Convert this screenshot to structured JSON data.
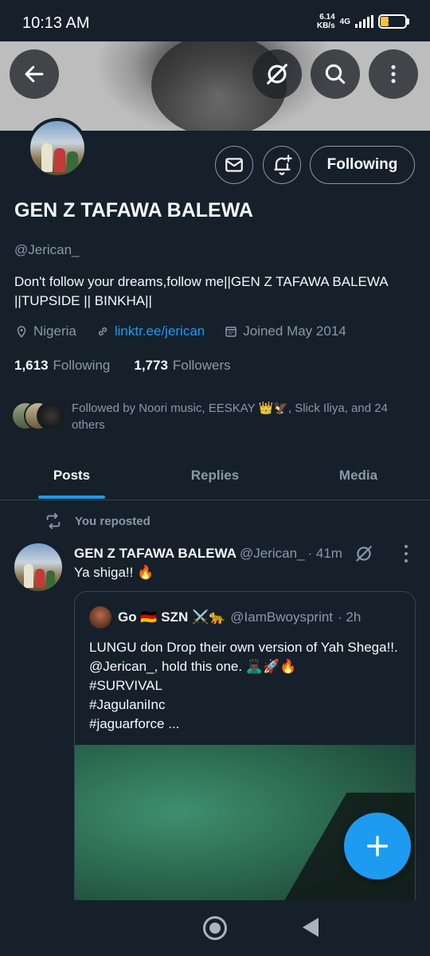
{
  "status_bar": {
    "time": "10:13 AM",
    "speed_value": "6.14",
    "speed_unit": "KB/s",
    "network": "4G",
    "battery": "32",
    "battery_level_percent": 32
  },
  "header": {
    "back_icon": "arrow-left-icon",
    "grok_icon": "slashed-circle-icon",
    "search_icon": "search-icon",
    "more_icon": "more-vertical-icon"
  },
  "profile": {
    "name": "GEN Z TAFAWA BALEWA",
    "handle": "@Jerican_",
    "bio": "Don't follow your dreams,follow me||GEN Z TAFAWA BALEWA ||TUPSIDE || BINKHA||",
    "location": "Nigeria",
    "link": "linktr.ee/jerican",
    "joined": "Joined May 2014",
    "following_count": "1,613",
    "following_label": "Following",
    "followers_count": "1,773",
    "followers_label": "Followers",
    "followed_by": "Followed by Noori music, EESKAY 👑🦅, Slick Iliya, and 24 others",
    "follow_button": "Following"
  },
  "tabs": [
    {
      "label": "Posts",
      "active": true
    },
    {
      "label": "Replies",
      "active": false
    },
    {
      "label": "Media",
      "active": false
    }
  ],
  "post": {
    "repost_label": "You reposted",
    "author_name": "GEN Z TAFAWA BALEWA",
    "author_handle": "@Jerican_",
    "time": "· 41m",
    "text": "Ya shiga!! 🔥",
    "quote": {
      "name": "Go 🇩🇪 SZN ⚔️🐆",
      "handle": "@IamBwoysprint",
      "time": "· 2h",
      "text": "LUNGU don Drop their own version of Yah Shega!!. @Jerican_,  hold this one. 🙇🏿‍♂️🚀🔥\n#SURVIVAL\n#JagulaniInc\n#jaguarforce ..."
    }
  },
  "colors": {
    "background": "#15202b",
    "accent": "#1d9bf0",
    "muted": "#8b98a5",
    "border": "#38444d"
  }
}
